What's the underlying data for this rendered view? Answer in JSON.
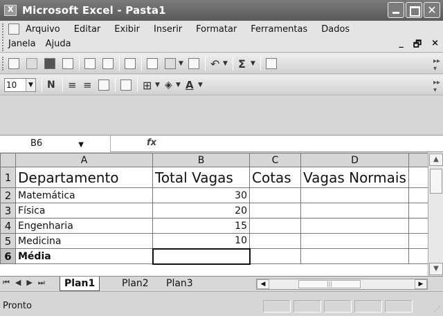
{
  "window": {
    "title": "Microsoft Excel - Pasta1",
    "min_label": "",
    "max_label": "",
    "close_label": "✕"
  },
  "menu": {
    "items": [
      "Arquivo",
      "Editar",
      "Exibir",
      "Inserir",
      "Formatar",
      "Ferramentas",
      "Dados"
    ],
    "row2": [
      "Janela",
      "Ajuda"
    ],
    "doc_min": "_",
    "doc_restore": "🗗",
    "doc_close": "×"
  },
  "format_toolbar": {
    "font_size": "10",
    "bold": "N",
    "font_color_letter": "A"
  },
  "formula_bar": {
    "name_box": "B6",
    "fx": "fx",
    "value": ""
  },
  "sheet": {
    "columns": [
      "A",
      "B",
      "C",
      "D"
    ],
    "rows": [
      {
        "num": "1",
        "cells": [
          "Departamento",
          "Total Vagas",
          "Cotas",
          "Vagas Normais"
        ]
      },
      {
        "num": "2",
        "cells": [
          "Matemática",
          "30",
          "",
          ""
        ]
      },
      {
        "num": "3",
        "cells": [
          "Física",
          "20",
          "",
          ""
        ]
      },
      {
        "num": "4",
        "cells": [
          "Engenharia",
          "15",
          "",
          ""
        ]
      },
      {
        "num": "5",
        "cells": [
          "Medicina",
          "10",
          "",
          ""
        ]
      },
      {
        "num": "6",
        "cells": [
          "Média",
          "",
          "",
          ""
        ]
      }
    ],
    "active_cell": "B6"
  },
  "tabs": [
    "Plan1",
    "Plan2",
    "Plan3"
  ],
  "active_tab": "Plan1",
  "status": "Pronto"
}
